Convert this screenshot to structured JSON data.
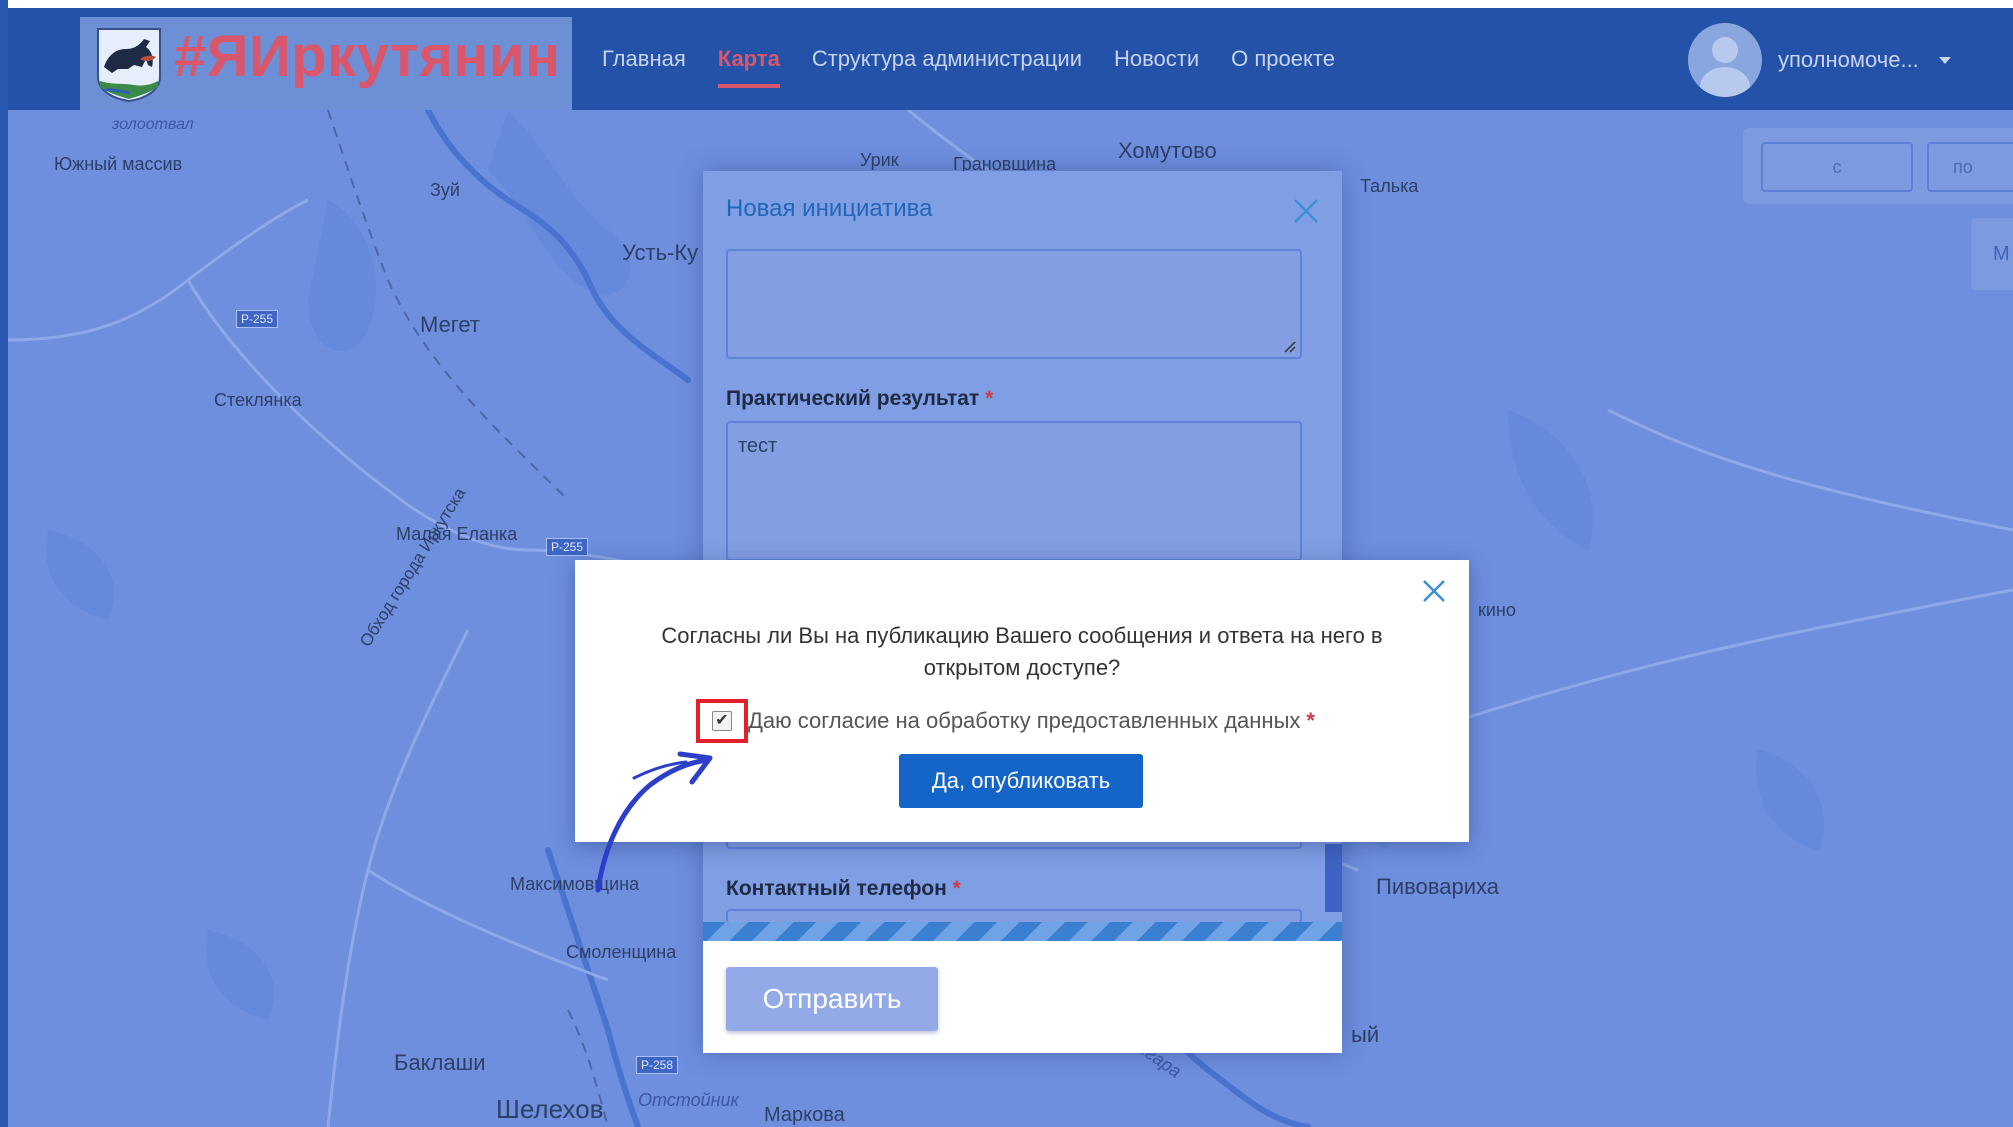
{
  "navbar": {
    "logo_text": "#ЯИркутянин",
    "items": [
      {
        "label": "Главная",
        "active": false
      },
      {
        "label": "Карта",
        "active": true
      },
      {
        "label": "Структура администрации",
        "active": false
      },
      {
        "label": "Новости",
        "active": false
      },
      {
        "label": "О проекте",
        "active": false
      }
    ],
    "user_name": "уполномоче..."
  },
  "map": {
    "labels": {
      "zolotoval": "золоотвал",
      "yuzhny": "Южный массив",
      "zuy": "Зуй",
      "uryk": "Урик",
      "granovshchina": "Грановщина",
      "khomutovo": "Хомутово",
      "talka": "Талька",
      "ust_ku": "Усть-Ку",
      "meget": "Мегет",
      "steklyanka": "Стеклянка",
      "malaya_elanka": "Малая Еланка",
      "obkhod": "Обход города Иркутска",
      "kino": "кино",
      "maksimovshchina": "Максимовщина",
      "smolenshchina": "Смоленщина",
      "pivovarikha": "Пивовариха",
      "baklashi": "Баклаши",
      "shelekhov": "Шелехов",
      "otstoynik": "Отстойник",
      "markova": "Маркова",
      "angara": "Ангара",
      "yy": "ый"
    },
    "roads": {
      "r255a": "Р-255",
      "r255b": "Р-255",
      "r258": "Р-258"
    },
    "controls": {
      "c_label": "с",
      "po_label": "по",
      "m_label": "М"
    }
  },
  "initiative_modal": {
    "title": "Новая инициатива",
    "practical_label": "Практический результат",
    "practical_value": "тест",
    "phone_label": "Контактный телефон",
    "required_mark": "*",
    "submit_label": "Отправить"
  },
  "confirm_dialog": {
    "question": "Согласны ли Вы на публикацию Вашего сообщения и ответа на него в открытом доступе?",
    "consent_label": "Даю согласие на обработку предоставленных данных",
    "consent_checked": true,
    "required_mark": "*",
    "publish_label": "Да, опубликовать"
  },
  "colors": {
    "brand": "#d9566b",
    "navbar": "#2352a8",
    "primary_button": "#1565c8",
    "highlight": "#e3202b",
    "annotation": "#2b3fc9"
  }
}
